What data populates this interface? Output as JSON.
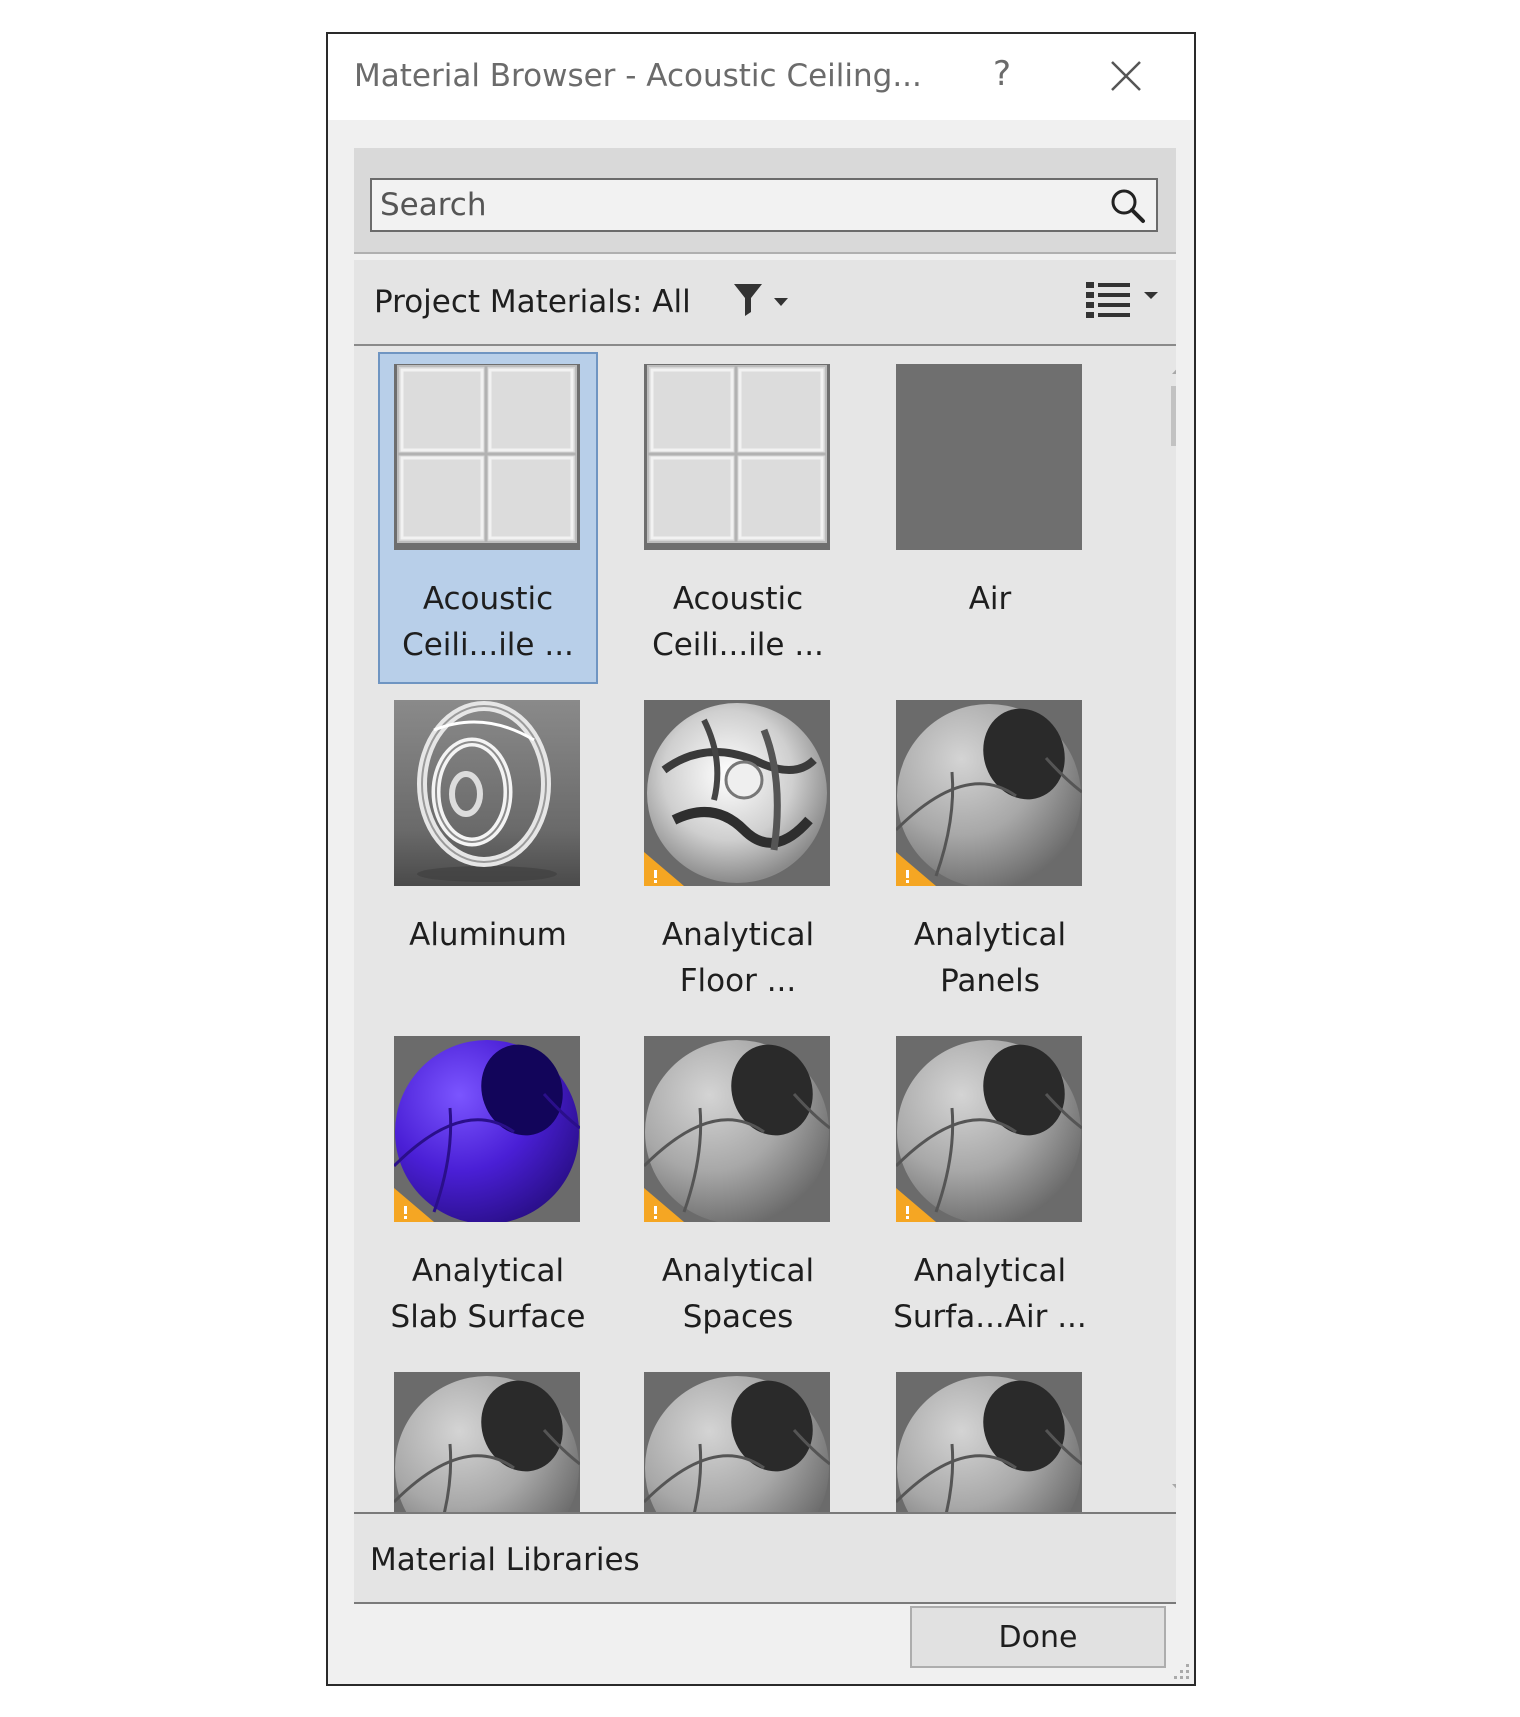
{
  "window": {
    "title": "Material Browser - Acoustic Ceiling...",
    "help_label": "?"
  },
  "search": {
    "placeholder": "Search",
    "value": ""
  },
  "filter": {
    "label": "Project Materials: All"
  },
  "materials": [
    {
      "label": "Acoustic\nCeili...ile ...",
      "thumbnail": "ceiling-tile",
      "selected": true,
      "warning": false
    },
    {
      "label": "Acoustic\nCeili...ile ...",
      "thumbnail": "ceiling-tile",
      "selected": false,
      "warning": false
    },
    {
      "label": "Air",
      "thumbnail": "flat-gray",
      "selected": false,
      "warning": false
    },
    {
      "label": "Aluminum",
      "thumbnail": "metal-rings",
      "selected": false,
      "warning": false
    },
    {
      "label": "Analytical\nFloor ...",
      "thumbnail": "chrome-sphere",
      "selected": false,
      "warning": true
    },
    {
      "label": "Analytical\nPanels",
      "thumbnail": "gray-sphere",
      "selected": false,
      "warning": true
    },
    {
      "label": "Analytical\nSlab Surface",
      "thumbnail": "purple-sphere",
      "selected": false,
      "warning": true
    },
    {
      "label": "Analytical\nSpaces",
      "thumbnail": "gray-sphere",
      "selected": false,
      "warning": true
    },
    {
      "label": "Analytical\nSurfa...Air ...",
      "thumbnail": "gray-sphere",
      "selected": false,
      "warning": true
    },
    {
      "label": "",
      "thumbnail": "gray-sphere",
      "selected": false,
      "warning": false
    },
    {
      "label": "",
      "thumbnail": "gray-sphere",
      "selected": false,
      "warning": false
    },
    {
      "label": "",
      "thumbnail": "gray-sphere",
      "selected": false,
      "warning": false
    }
  ],
  "libraries": {
    "label": "Material Libraries"
  },
  "footer": {
    "done_label": "Done"
  },
  "colors": {
    "selection": "#b8cfe9",
    "selection_border": "#6f95c2",
    "warning": "#f5a623",
    "sphere_purple": "#4a1fd6"
  }
}
